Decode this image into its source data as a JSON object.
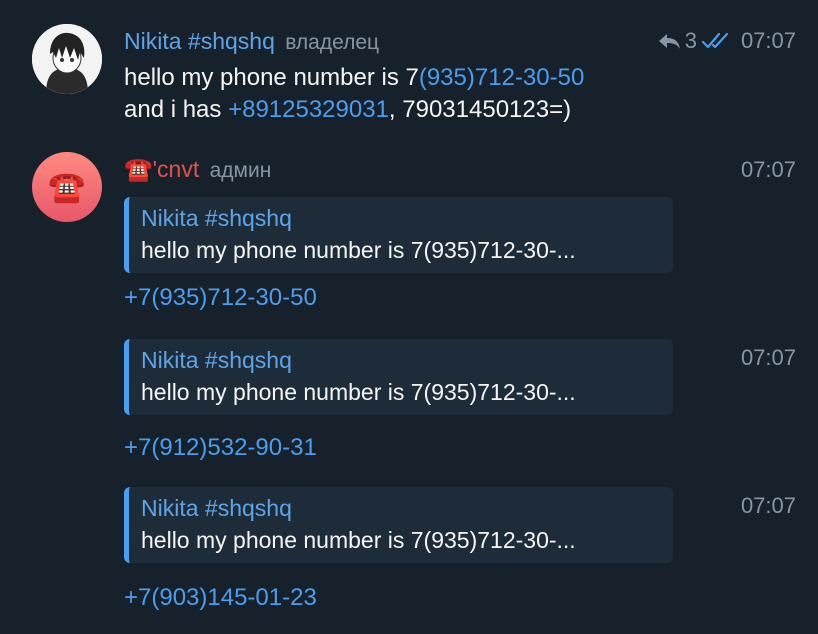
{
  "messages": [
    {
      "sender": "Nikita #shqshq",
      "role": "владелец",
      "reply_count": "3",
      "time": "07:07",
      "line1_prefix": "hello my phone number is 7",
      "line1_link": "(935)712-30-50",
      "line2_prefix": "and i has ",
      "line2_link": "+89125329031",
      "line2_suffix": ", 79031450123=)"
    },
    {
      "sender_emoji": "☎️",
      "sender": "'cnvt",
      "role": "админ",
      "time": "07:07",
      "reply_name": "Nikita #shqshq",
      "reply_text": "hello my phone number is 7(935)712-30-...",
      "link": "+7(935)712-30-50"
    },
    {
      "time": "07:07",
      "reply_name": "Nikita #shqshq",
      "reply_text": "hello my phone number is 7(935)712-30-...",
      "link": "+7(912)532-90-31"
    },
    {
      "time": "07:07",
      "reply_name": "Nikita #shqshq",
      "reply_text": "hello my phone number is 7(935)712-30-...",
      "link": "+7(903)145-01-23"
    }
  ],
  "colors": {
    "background": "#17212b",
    "link": "#4a9ef0",
    "sender_blue": "#5ea4e8",
    "sender_red": "#e3534e",
    "muted": "#8796a5",
    "reply_bg": "#1e2c3a"
  },
  "icons": {
    "reply_arrow": "reply-arrow-icon",
    "read_check": "double-check-icon",
    "avatar_2": "telephone-icon"
  }
}
